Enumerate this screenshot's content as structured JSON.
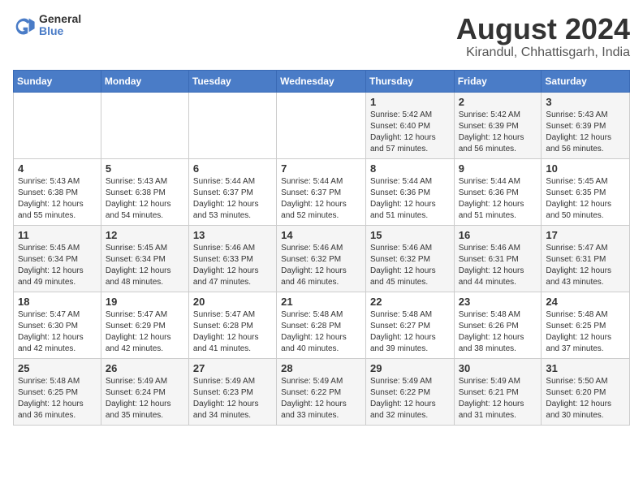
{
  "logo": {
    "general": "General",
    "blue": "Blue"
  },
  "title": "August 2024",
  "subtitle": "Kirandul, Chhattisgarh, India",
  "weekdays": [
    "Sunday",
    "Monday",
    "Tuesday",
    "Wednesday",
    "Thursday",
    "Friday",
    "Saturday"
  ],
  "weeks": [
    [
      {
        "day": "",
        "sunrise": "",
        "sunset": "",
        "daylight": ""
      },
      {
        "day": "",
        "sunrise": "",
        "sunset": "",
        "daylight": ""
      },
      {
        "day": "",
        "sunrise": "",
        "sunset": "",
        "daylight": ""
      },
      {
        "day": "",
        "sunrise": "",
        "sunset": "",
        "daylight": ""
      },
      {
        "day": "1",
        "sunrise": "Sunrise: 5:42 AM",
        "sunset": "Sunset: 6:40 PM",
        "daylight": "Daylight: 12 hours and 57 minutes."
      },
      {
        "day": "2",
        "sunrise": "Sunrise: 5:42 AM",
        "sunset": "Sunset: 6:39 PM",
        "daylight": "Daylight: 12 hours and 56 minutes."
      },
      {
        "day": "3",
        "sunrise": "Sunrise: 5:43 AM",
        "sunset": "Sunset: 6:39 PM",
        "daylight": "Daylight: 12 hours and 56 minutes."
      }
    ],
    [
      {
        "day": "4",
        "sunrise": "Sunrise: 5:43 AM",
        "sunset": "Sunset: 6:38 PM",
        "daylight": "Daylight: 12 hours and 55 minutes."
      },
      {
        "day": "5",
        "sunrise": "Sunrise: 5:43 AM",
        "sunset": "Sunset: 6:38 PM",
        "daylight": "Daylight: 12 hours and 54 minutes."
      },
      {
        "day": "6",
        "sunrise": "Sunrise: 5:44 AM",
        "sunset": "Sunset: 6:37 PM",
        "daylight": "Daylight: 12 hours and 53 minutes."
      },
      {
        "day": "7",
        "sunrise": "Sunrise: 5:44 AM",
        "sunset": "Sunset: 6:37 PM",
        "daylight": "Daylight: 12 hours and 52 minutes."
      },
      {
        "day": "8",
        "sunrise": "Sunrise: 5:44 AM",
        "sunset": "Sunset: 6:36 PM",
        "daylight": "Daylight: 12 hours and 51 minutes."
      },
      {
        "day": "9",
        "sunrise": "Sunrise: 5:44 AM",
        "sunset": "Sunset: 6:36 PM",
        "daylight": "Daylight: 12 hours and 51 minutes."
      },
      {
        "day": "10",
        "sunrise": "Sunrise: 5:45 AM",
        "sunset": "Sunset: 6:35 PM",
        "daylight": "Daylight: 12 hours and 50 minutes."
      }
    ],
    [
      {
        "day": "11",
        "sunrise": "Sunrise: 5:45 AM",
        "sunset": "Sunset: 6:34 PM",
        "daylight": "Daylight: 12 hours and 49 minutes."
      },
      {
        "day": "12",
        "sunrise": "Sunrise: 5:45 AM",
        "sunset": "Sunset: 6:34 PM",
        "daylight": "Daylight: 12 hours and 48 minutes."
      },
      {
        "day": "13",
        "sunrise": "Sunrise: 5:46 AM",
        "sunset": "Sunset: 6:33 PM",
        "daylight": "Daylight: 12 hours and 47 minutes."
      },
      {
        "day": "14",
        "sunrise": "Sunrise: 5:46 AM",
        "sunset": "Sunset: 6:32 PM",
        "daylight": "Daylight: 12 hours and 46 minutes."
      },
      {
        "day": "15",
        "sunrise": "Sunrise: 5:46 AM",
        "sunset": "Sunset: 6:32 PM",
        "daylight": "Daylight: 12 hours and 45 minutes."
      },
      {
        "day": "16",
        "sunrise": "Sunrise: 5:46 AM",
        "sunset": "Sunset: 6:31 PM",
        "daylight": "Daylight: 12 hours and 44 minutes."
      },
      {
        "day": "17",
        "sunrise": "Sunrise: 5:47 AM",
        "sunset": "Sunset: 6:31 PM",
        "daylight": "Daylight: 12 hours and 43 minutes."
      }
    ],
    [
      {
        "day": "18",
        "sunrise": "Sunrise: 5:47 AM",
        "sunset": "Sunset: 6:30 PM",
        "daylight": "Daylight: 12 hours and 42 minutes."
      },
      {
        "day": "19",
        "sunrise": "Sunrise: 5:47 AM",
        "sunset": "Sunset: 6:29 PM",
        "daylight": "Daylight: 12 hours and 42 minutes."
      },
      {
        "day": "20",
        "sunrise": "Sunrise: 5:47 AM",
        "sunset": "Sunset: 6:28 PM",
        "daylight": "Daylight: 12 hours and 41 minutes."
      },
      {
        "day": "21",
        "sunrise": "Sunrise: 5:48 AM",
        "sunset": "Sunset: 6:28 PM",
        "daylight": "Daylight: 12 hours and 40 minutes."
      },
      {
        "day": "22",
        "sunrise": "Sunrise: 5:48 AM",
        "sunset": "Sunset: 6:27 PM",
        "daylight": "Daylight: 12 hours and 39 minutes."
      },
      {
        "day": "23",
        "sunrise": "Sunrise: 5:48 AM",
        "sunset": "Sunset: 6:26 PM",
        "daylight": "Daylight: 12 hours and 38 minutes."
      },
      {
        "day": "24",
        "sunrise": "Sunrise: 5:48 AM",
        "sunset": "Sunset: 6:25 PM",
        "daylight": "Daylight: 12 hours and 37 minutes."
      }
    ],
    [
      {
        "day": "25",
        "sunrise": "Sunrise: 5:48 AM",
        "sunset": "Sunset: 6:25 PM",
        "daylight": "Daylight: 12 hours and 36 minutes."
      },
      {
        "day": "26",
        "sunrise": "Sunrise: 5:49 AM",
        "sunset": "Sunset: 6:24 PM",
        "daylight": "Daylight: 12 hours and 35 minutes."
      },
      {
        "day": "27",
        "sunrise": "Sunrise: 5:49 AM",
        "sunset": "Sunset: 6:23 PM",
        "daylight": "Daylight: 12 hours and 34 minutes."
      },
      {
        "day": "28",
        "sunrise": "Sunrise: 5:49 AM",
        "sunset": "Sunset: 6:22 PM",
        "daylight": "Daylight: 12 hours and 33 minutes."
      },
      {
        "day": "29",
        "sunrise": "Sunrise: 5:49 AM",
        "sunset": "Sunset: 6:22 PM",
        "daylight": "Daylight: 12 hours and 32 minutes."
      },
      {
        "day": "30",
        "sunrise": "Sunrise: 5:49 AM",
        "sunset": "Sunset: 6:21 PM",
        "daylight": "Daylight: 12 hours and 31 minutes."
      },
      {
        "day": "31",
        "sunrise": "Sunrise: 5:50 AM",
        "sunset": "Sunset: 6:20 PM",
        "daylight": "Daylight: 12 hours and 30 minutes."
      }
    ]
  ]
}
